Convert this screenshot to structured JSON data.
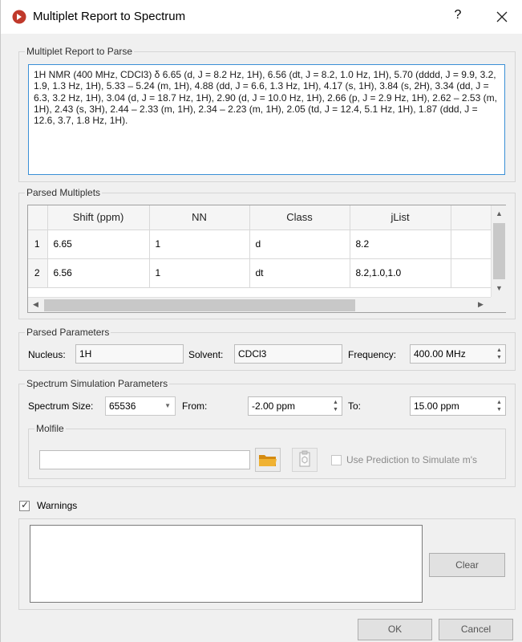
{
  "title": "Multiplet Report to Spectrum",
  "help_label": "?",
  "report": {
    "legend": "Multiplet Report to Parse",
    "text": "1H NMR (400 MHz, CDCl3) δ 6.65 (d, J = 8.2 Hz, 1H), 6.56 (dt, J = 8.2, 1.0 Hz, 1H), 5.70 (dddd, J = 9.9, 3.2, 1.9, 1.3 Hz, 1H), 5.33 – 5.24 (m, 1H), 4.88 (dd, J = 6.6, 1.3 Hz, 1H), 4.17 (s, 1H), 3.84 (s, 2H), 3.34 (dd, J = 6.3, 3.2 Hz, 1H), 3.04 (d, J = 18.7 Hz, 1H), 2.90 (d, J = 10.0 Hz, 1H), 2.66 (p, J = 2.9 Hz, 1H), 2.62 – 2.53 (m, 1H), 2.43 (s, 3H), 2.44 – 2.33 (m, 1H), 2.34 – 2.23 (m, 1H), 2.05 (td, J = 12.4, 5.1 Hz, 1H), 1.87 (ddd, J = 12.6, 3.7, 1.8 Hz, 1H)."
  },
  "multiplets": {
    "legend": "Parsed Multiplets",
    "columns": [
      "Shift (ppm)",
      "NN",
      "Class",
      "jList"
    ],
    "rows": [
      {
        "num": "1",
        "shift": "6.65",
        "nn": "1",
        "cls": "d",
        "jlist": "8.2"
      },
      {
        "num": "2",
        "shift": "6.56",
        "nn": "1",
        "cls": "dt",
        "jlist": "8.2,1.0,1.0"
      }
    ]
  },
  "params": {
    "legend": "Parsed Parameters",
    "nucleus_label": "Nucleus:",
    "nucleus_value": "1H",
    "solvent_label": "Solvent:",
    "solvent_value": "CDCl3",
    "frequency_label": "Frequency:",
    "frequency_value": "400.00 MHz"
  },
  "simulation": {
    "legend": "Spectrum Simulation Parameters",
    "size_label": "Spectrum Size:",
    "size_value": "65536",
    "from_label": "From:",
    "from_value": "-2.00 ppm",
    "to_label": "To:",
    "to_value": "15.00 ppm",
    "molfile_legend": "Molfile",
    "molfile_value": "",
    "prediction_label": "Use Prediction to Simulate m's",
    "prediction_checked": false
  },
  "warnings": {
    "label": "Warnings",
    "checked": true,
    "clear_label": "Clear"
  },
  "footer": {
    "ok_label": "OK",
    "cancel_label": "Cancel"
  },
  "colors": {
    "accent": "#3a8fd6",
    "app_icon": "#c0392b",
    "folder_icon": "#e8a21a"
  }
}
